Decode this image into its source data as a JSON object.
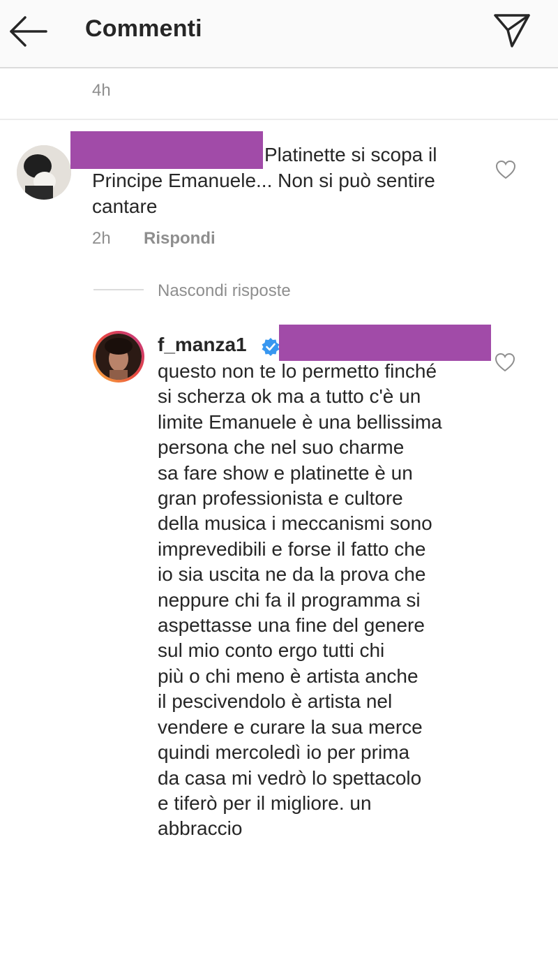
{
  "header": {
    "title": "Commenti",
    "back_icon": "arrow-left-icon",
    "send_icon": "paper-plane-icon"
  },
  "previous": {
    "time": "4h"
  },
  "comment": {
    "text": "Platinette si scopa il Principe Emanuele... Non si può sentire cantare",
    "time": "2h",
    "reply_label": "Rispondi"
  },
  "replies_toggle": "Nascondi risposte",
  "reply": {
    "username": "f_manza1",
    "text": "questo non te lo permetto finché\nsi scherza ok ma a  tutto c'è un\nlimite Emanuele è una bellissima\npersona che nel suo charme\nsa fare show e platinette è un\ngran professionista e cultore\ndella musica i meccanismi sono\nimprevedibili e forse il fatto che\nio sia uscita ne da la prova che\nneppure chi fa il programma si\naspettasse una fine del genere\nsul mio conto ergo tutti chi\npiù o chi meno è artista anche\nil pescivendolo è artista nel\nvendere e curare la sua merce\nquindi mercoledì io per prima\nda casa mi vedrò lo spettacolo\ne tiferò per il migliore. un\nabbraccio"
  },
  "colors": {
    "redaction": "#a14ba8",
    "verified": "#3897f0",
    "secondary_text": "#8e8e8e"
  }
}
